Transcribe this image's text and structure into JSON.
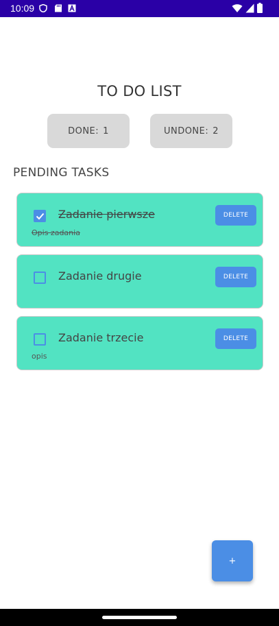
{
  "status_bar": {
    "time": "10:09",
    "icons": [
      "shield-icon",
      "sd-card-icon",
      "a-icon",
      "wifi-icon",
      "signal-icon",
      "battery-icon"
    ]
  },
  "app": {
    "title": "TO DO LIST",
    "counters": {
      "done_label": "DONE:",
      "done_value": "1",
      "undone_label": "UNDONE:",
      "undone_value": "2"
    },
    "section_title": "PENDING TASKS",
    "tasks": [
      {
        "name": "Zadanie pierwsze",
        "description": "Opis zadania",
        "checked": true,
        "delete_label": "DELETE"
      },
      {
        "name": "Zadanie drugie",
        "description": "",
        "checked": false,
        "delete_label": "DELETE"
      },
      {
        "name": "Zadanie trzecie",
        "description": "opis",
        "checked": false,
        "delete_label": "DELETE"
      }
    ],
    "fab_label": "+"
  },
  "colors": {
    "status_bar": "#2a00a6",
    "card": "#52e3c2",
    "accent": "#4b8ee5",
    "counter_bg": "#d9d9d9"
  }
}
